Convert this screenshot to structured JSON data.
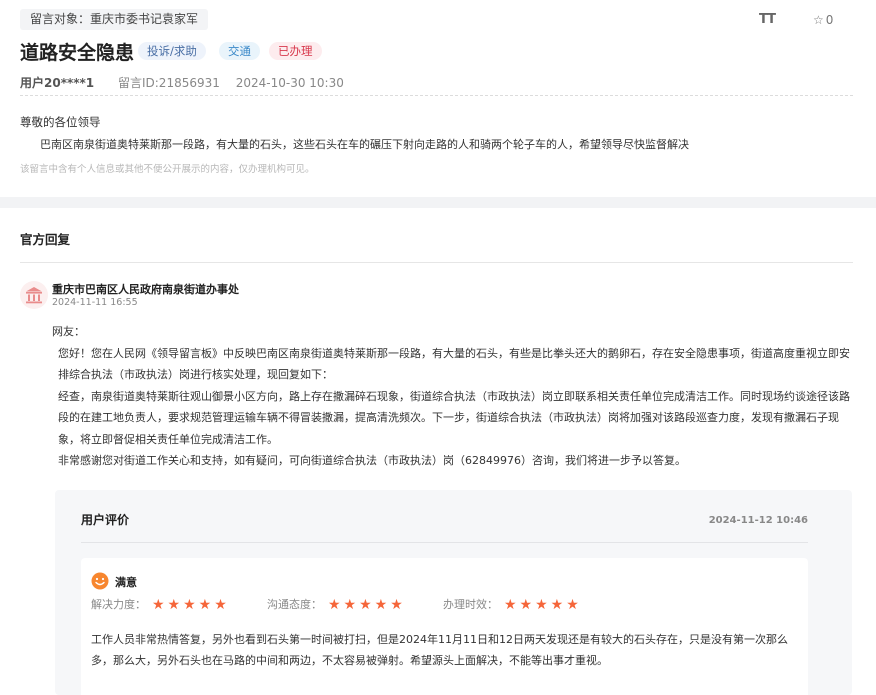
{
  "header": {
    "target_tag": "留言对象：重庆市委书记袁家军",
    "font_toggle": "TT",
    "fav_count": "0",
    "title": "道路安全隐患",
    "chips": [
      "投诉/求助",
      "交通",
      "已办理"
    ],
    "user": "用户20****1",
    "message_id": "留言ID:21856931",
    "datetime": "2024-10-30 10:30"
  },
  "message": {
    "greeting": "尊敬的各位领导",
    "body": "巴南区南泉街道奥特莱斯那一段路，有大量的石头，这些石头在车的碾压下射向走路的人和骑两个轮子车的人，希望领导尽快监督解决",
    "note": "该留言中含有个人信息或其他不便公开展示的内容，仅办理机构可见。"
  },
  "reply": {
    "heading": "官方回复",
    "org": "重庆市巴南区人民政府南泉街道办事处",
    "date": "2024-11-11 16:55",
    "paragraphs": [
      "网友：",
      "您好！您在人民网《领导留言板》中反映巴南区南泉街道奥特莱斯那一段路，有大量的石头，有些是比拳头还大的鹅卵石，存在安全隐患事项，街道高度重视立即安排综合执法（市政执法）岗进行核实处理，现回复如下：",
      "经查，南泉街道奥特莱斯往观山御景小区方向，路上存在撒漏碎石现象，街道综合执法（市政执法）岗立即联系相关责任单位完成清洁工作。同时现场约谈途径该路段的在建工地负责人，要求规范管理运输车辆不得冒装撒漏，提高清洗频次。下一步，街道综合执法（市政执法）岗将加强对该路段巡查力度，发现有撒漏石子现象，将立即督促相关责任单位完成清洁工作。",
      "非常感谢您对街道工作关心和支持，如有疑问，可向街道综合执法（市政执法）岗（62849976）咨询，我们将进一步予以答复。"
    ]
  },
  "evaluation": {
    "title": "用户评价",
    "date": "2024-11-12 10:46",
    "overall": "满意",
    "ratings": [
      {
        "label": "解决力度：",
        "stars": 5
      },
      {
        "label": "沟通态度：",
        "stars": 5
      },
      {
        "label": "办理时效：",
        "stars": 5
      }
    ],
    "comment": "工作人员非常热情答复，另外也看到石头第一时间被打扫，但是2024年11月11日和12日两天发现还是有较大的石头存在，只是没有第一次那么多，那么大，另外石头也在马路的中间和两边，不太容易被弹射。希望源头上面解决，不能等出事才重视。"
  },
  "colors": {
    "accent_red": "#d8394d",
    "star": "#f5663a",
    "link_blue": "#3a89c9"
  }
}
